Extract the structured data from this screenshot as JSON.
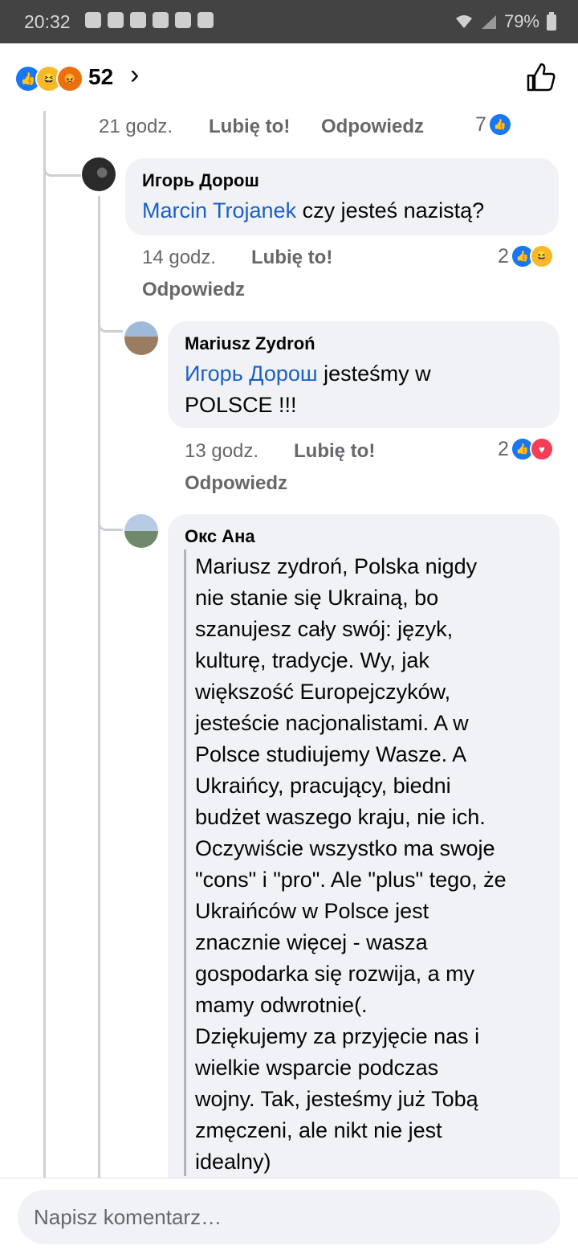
{
  "status": {
    "time": "20:32",
    "battery": "79%"
  },
  "header": {
    "reaction_count": "52"
  },
  "top_meta": {
    "time": "21 godz.",
    "like": "Lubię to!",
    "reply": "Odpowiedz",
    "count": "7"
  },
  "comments": [
    {
      "author": "Игорь Дорош",
      "mention": "Marcin Trojanek",
      "text": " czy jesteś nazistą?",
      "time": "14 godz.",
      "like": "Lubię to!",
      "reply": "Odpowiedz",
      "reaction_count": "2"
    },
    {
      "author": "Mariusz Zydroń",
      "mention": "Игорь Дорош",
      "text_line1": " jesteśmy w",
      "text_line2": "POLSCE !!!",
      "time": "13 godz.",
      "like": "Lubię to!",
      "reply": "Odpowiedz",
      "reaction_count": "2"
    },
    {
      "author": "Окс Ана",
      "lines": [
        "Mariusz zydroń, Polska nigdy",
        "nie stanie się Ukrainą, bo",
        "szanujesz cały swój: język,",
        "kulturę, tradycje. Wy, jak",
        "większość Europejczyków,",
        "jesteście nacjonalistami. A w",
        "Polsce studiujemy Wasze. A",
        "Ukraińcy, pracujący, biedni",
        "budżet waszego kraju, nie ich.",
        "Oczywiście wszystko ma swoje",
        "\"cons\" i \"pro\". Ale \"plus\" tego, że",
        "Ukraińców w Polsce jest",
        "znacznie więcej - wasza",
        "gospodarka się rozwija, a my",
        "mamy odwrotnie(.",
        "Dziękujemy za przyjęcie nas i",
        "wielkie wsparcie podczas",
        "wojny. Tak, jesteśmy już Tobą",
        "zmęczeni, ale nikt nie jest",
        "idealny)"
      ]
    }
  ],
  "composer": {
    "placeholder": "Napisz komentarz…"
  },
  "colors": {
    "like_blue": "#1877f2",
    "mention_blue": "#1b5fc7",
    "bubble_gray": "#f0f2f5"
  }
}
